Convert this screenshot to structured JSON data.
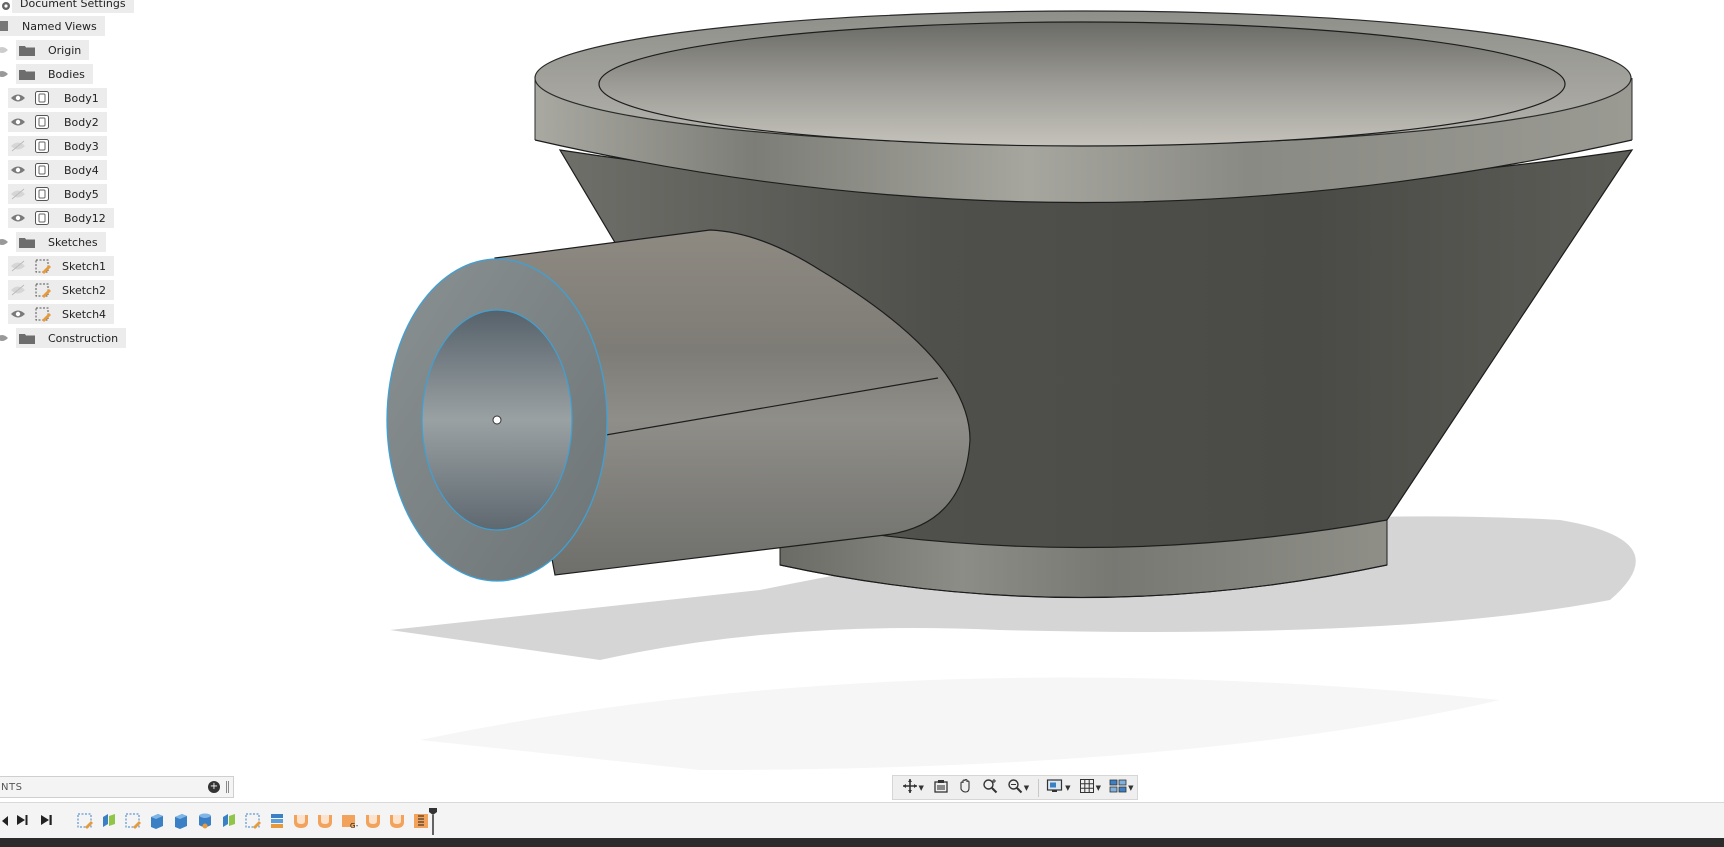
{
  "browser": {
    "document_settings": "Document Settings",
    "named_views": "Named Views",
    "origin": "Origin",
    "bodies": {
      "label": "Bodies",
      "items": [
        {
          "label": "Body1",
          "visible": true
        },
        {
          "label": "Body2",
          "visible": true
        },
        {
          "label": "Body3",
          "visible": false
        },
        {
          "label": "Body4",
          "visible": true
        },
        {
          "label": "Body5",
          "visible": false
        },
        {
          "label": "Body12",
          "visible": true
        }
      ]
    },
    "sketches": {
      "label": "Sketches",
      "items": [
        {
          "label": "Sketch1",
          "visible": false
        },
        {
          "label": "Sketch2",
          "visible": false
        },
        {
          "label": "Sketch4",
          "visible": true
        }
      ]
    },
    "construction": "Construction"
  },
  "comments": {
    "title": "NTS"
  },
  "navbar": {
    "icons": [
      "orbit-icon",
      "look-at-icon",
      "pan-icon",
      "zoom-icon",
      "fit-icon",
      "display-settings-icon",
      "grid-settings-icon",
      "viewports-icon"
    ]
  },
  "timeline": {
    "controls": [
      "step-back-icon",
      "play-icon",
      "step-end-icon"
    ],
    "features": [
      "sketch",
      "extrude",
      "sketch",
      "body",
      "body",
      "revolve",
      "extrude",
      "sketch",
      "shell",
      "fillet",
      "fillet",
      "combine",
      "fillet",
      "fillet",
      "chamfer"
    ]
  },
  "colors": {
    "accent": "#3ea1d6",
    "model": "#8a8a86",
    "timeline_feature": "#f2a25a"
  }
}
